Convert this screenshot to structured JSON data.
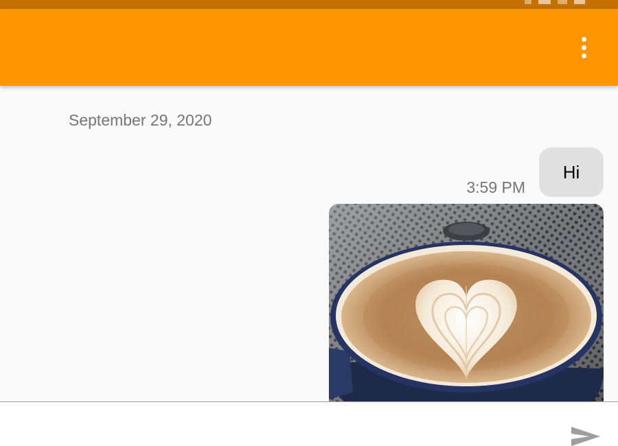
{
  "status_bar": {
    "background": "#c57100"
  },
  "app_bar": {
    "background": "#ff9500",
    "menu_icon": "more-vert-icon"
  },
  "conversation": {
    "date_header": "September 29, 2020",
    "messages": [
      {
        "type": "text",
        "text": "Hi",
        "time": "3:59 PM",
        "outgoing": true
      },
      {
        "type": "image",
        "subject": "latte art coffee cup",
        "outgoing": true
      }
    ]
  },
  "compose": {
    "value": "",
    "send_icon": "send-icon"
  },
  "colors": {
    "accent": "#ff9500",
    "bubble": "#e0e0e0",
    "secondary_text": "#757575"
  }
}
